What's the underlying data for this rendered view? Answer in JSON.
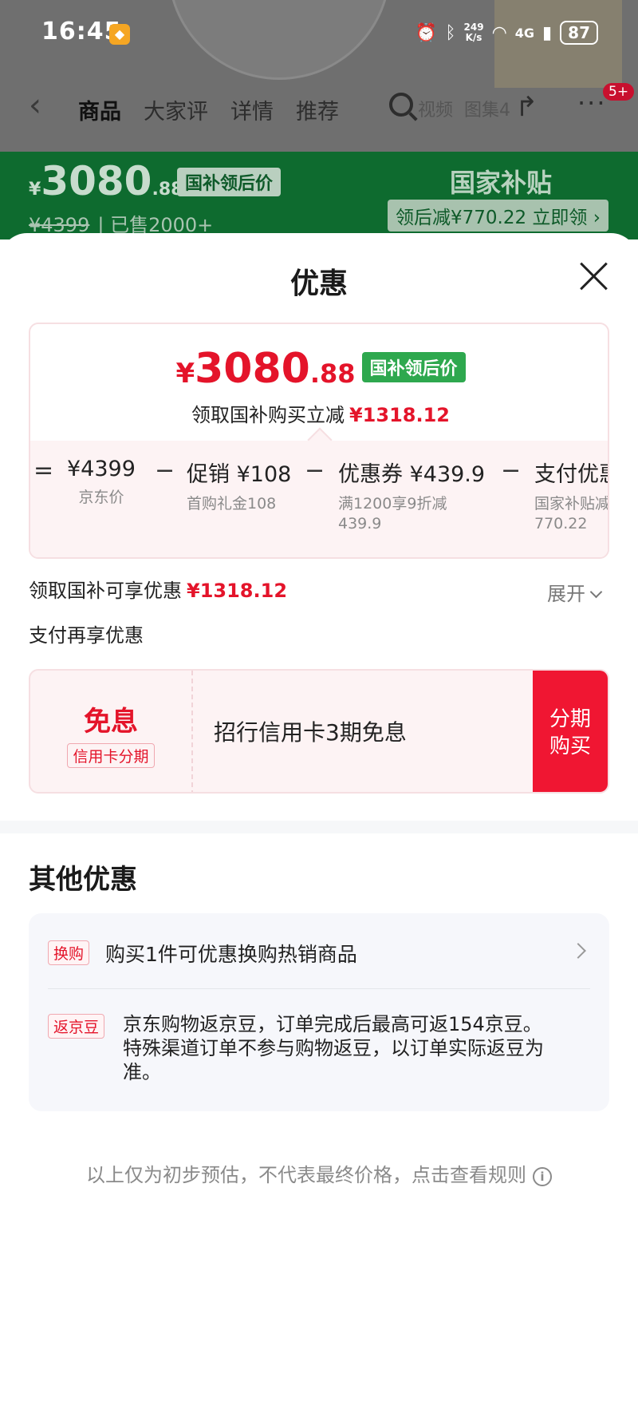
{
  "status_bar": {
    "time": "16:45",
    "net_speed": "249",
    "net_unit": "K/s",
    "network": "4G",
    "battery": "87"
  },
  "nav": {
    "tabs": [
      "商品",
      "大家评",
      "详情",
      "推荐"
    ],
    "faded_label_1": "视频",
    "faded_label_2": "图集4",
    "cart_badge": "5+"
  },
  "product_header": {
    "currency": "¥",
    "price_int": "3080",
    "price_dec": ".88",
    "price_tag": "国补领后价",
    "original_price": "¥4399",
    "sold": "已售2000+",
    "subsidy_title": "国家补贴",
    "subsidy_claim": "领后减¥770.22 立即领 ›"
  },
  "sheet": {
    "title": "优惠",
    "final_price": {
      "currency": "¥",
      "int": "3080",
      "dec": ".88",
      "tag": "国补领后价"
    },
    "save_label": "领取国补购买立减",
    "save_amount": "¥1318.12",
    "breakdown": [
      {
        "main": "¥4399",
        "sub": "京东价"
      },
      {
        "main": "促销 ¥108",
        "sub": "首购礼金108"
      },
      {
        "main": "优惠券 ¥439.9",
        "sub": "满1200享9折减",
        "sub2": "439.9"
      },
      {
        "main": "支付优惠",
        "sub": "国家补贴减",
        "sub2": "770.22"
      }
    ],
    "operator_equal": "=",
    "operator_minus": "−",
    "claimable_label": "领取国补可享优惠",
    "claimable_amount": "¥1318.12",
    "expand_label": "展开",
    "pay_section_title": "支付再享优惠",
    "pay_card": {
      "title": "免息",
      "subtitle": "信用卡分期",
      "description": "招行信用卡3期免息",
      "button_line1": "分期",
      "button_line2": "购买"
    },
    "other_title": "其他优惠",
    "other_items": [
      {
        "tag": "换购",
        "text": "购买1件可优惠换购热销商品"
      },
      {
        "tag": "返京豆",
        "text": "京东购物返京豆，订单完成后最高可返154京豆。特殊渠道订单不参与购物返豆，以订单实际返豆为准。"
      }
    ],
    "footnote": "以上仅为初步预估，不代表最终价格，点击查看规则"
  },
  "colors": {
    "accent_red": "#e4142a",
    "button_red": "#f01632",
    "tag_green": "#2ea84e",
    "header_green": "#0e6b2f"
  }
}
